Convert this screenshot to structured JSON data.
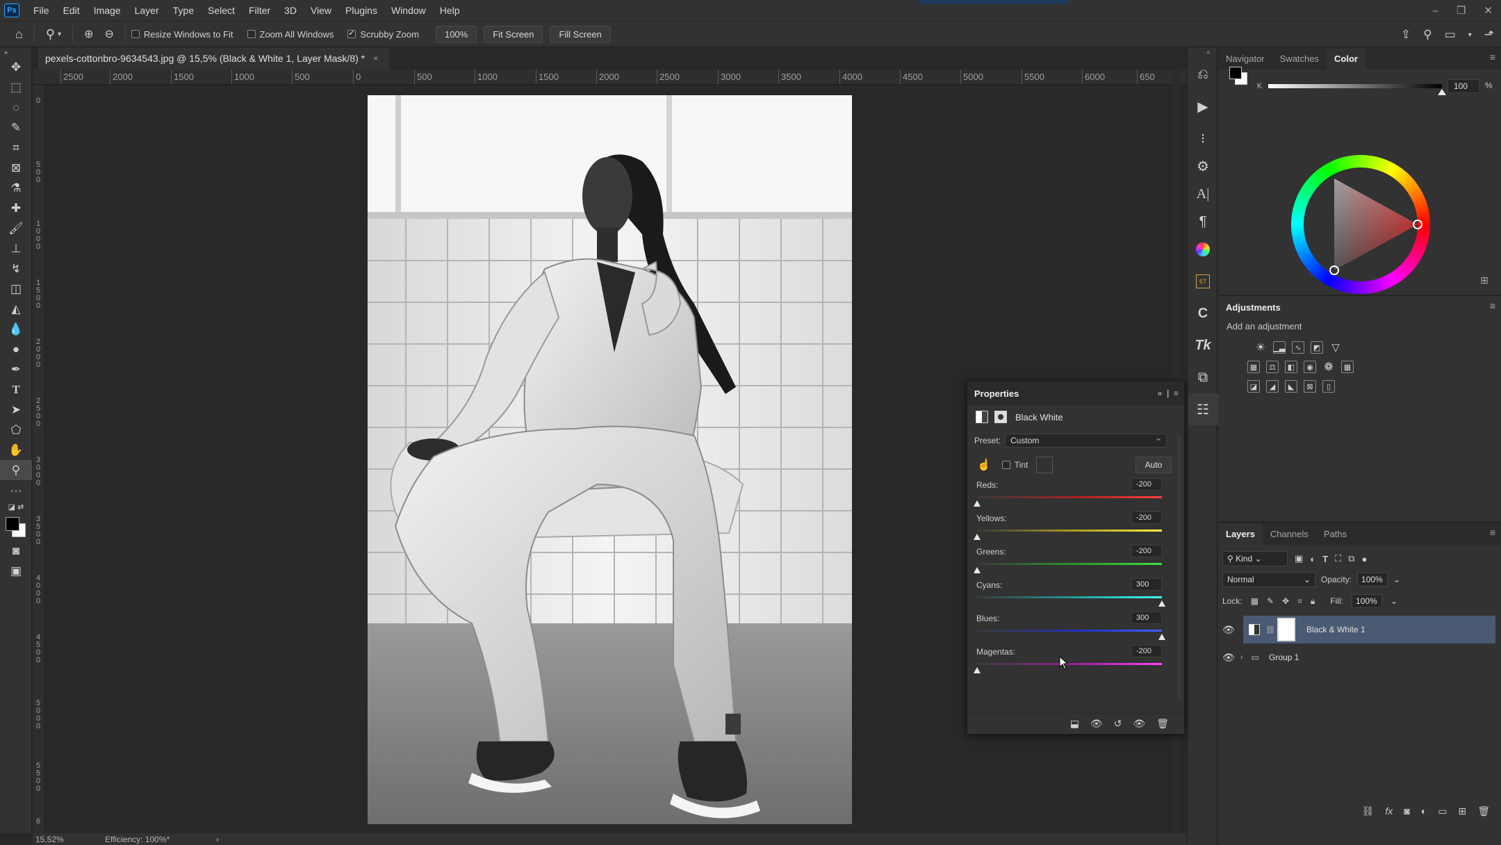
{
  "app": {
    "logo": "Ps"
  },
  "menu": [
    "File",
    "Edit",
    "Image",
    "Layer",
    "Type",
    "Select",
    "Filter",
    "3D",
    "View",
    "Plugins",
    "Window",
    "Help"
  ],
  "options_bar": {
    "resize_windows": "Resize Windows to Fit",
    "zoom_all": "Zoom All Windows",
    "scrubby_zoom": "Scrubby Zoom",
    "zoom_value": "100%",
    "fit_screen": "Fit Screen",
    "fill_screen": "Fill Screen",
    "scrubby_checked": true
  },
  "document": {
    "tab_title": "pexels-cottonbro-9634543.jpg @ 15,5% (Black & White 1, Layer Mask/8) *",
    "close": "×"
  },
  "ruler": {
    "h_labels": [
      "2500",
      "2000",
      "1500",
      "1000",
      "500",
      "0",
      "500",
      "1000",
      "1500",
      "2000",
      "2500",
      "3000",
      "3500",
      "4000",
      "4500",
      "5000",
      "5500",
      "6000",
      "650"
    ],
    "v_labels": [
      "0",
      "500",
      "1000",
      "1500",
      "2000",
      "2500",
      "3000",
      "3500",
      "4000",
      "4500",
      "5000",
      "5500",
      "6"
    ]
  },
  "status": {
    "zoom": "15,52%",
    "efficiency": "Efficiency: 100%*",
    "arrow": "›"
  },
  "color_panel": {
    "tabs": [
      "Navigator",
      "Swatches",
      "Color"
    ],
    "active_tab": "Color",
    "k_label": "K",
    "k_value": "100",
    "k_unit": "%",
    "k_level": 1.0
  },
  "adjustments": {
    "title": "Adjustments",
    "subtitle": "Add an adjustment"
  },
  "layers_panel": {
    "tabs": [
      "Layers",
      "Channels",
      "Paths"
    ],
    "active_tab": "Layers",
    "kind": "Kind",
    "blend_mode": "Normal",
    "opacity_label": "Opacity:",
    "opacity": "100%",
    "lock_label": "Lock:",
    "fill_label": "Fill:",
    "fill": "100%",
    "layers": [
      {
        "name": "Black & White 1",
        "selected": true
      },
      {
        "name": "Group 1",
        "selected": false
      }
    ]
  },
  "properties": {
    "title": "Properties",
    "adjustment_name": "Black  White",
    "preset_label": "Preset:",
    "preset_value": "Custom",
    "tint_label": "Tint",
    "auto_label": "Auto",
    "sliders": [
      {
        "label": "Reds:",
        "value": "-200",
        "level": 0.0,
        "gradient": "linear-gradient(to right,#3a3a3a,#b02020 55%,#ff4040)"
      },
      {
        "label": "Yellows:",
        "value": "-200",
        "level": 0.0,
        "gradient": "linear-gradient(to right,#3a3a3a,#b0a020 55%,#ffee40)"
      },
      {
        "label": "Greens:",
        "value": "-200",
        "level": 0.0,
        "gradient": "linear-gradient(to right,#3a3a3a,#2a9a2a 55%,#40e040)"
      },
      {
        "label": "Cyans:",
        "value": "300",
        "level": 1.0,
        "gradient": "linear-gradient(to right,#3a3a3a,#20a0a0 55%,#40ffff)"
      },
      {
        "label": "Blues:",
        "value": "300",
        "level": 1.0,
        "gradient": "linear-gradient(to right,#3a3a3a,#2030c0 55%,#4060ff)"
      },
      {
        "label": "Magentas:",
        "value": "-200",
        "level": 0.0,
        "gradient": "linear-gradient(to right,#3a3a3a,#a020a0 55%,#ff40ff)"
      }
    ]
  }
}
